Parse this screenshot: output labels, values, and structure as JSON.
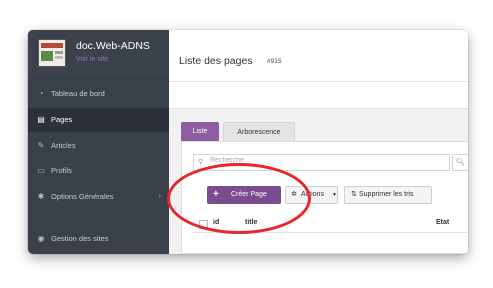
{
  "site": {
    "name": "doc.Web-ADNS",
    "view_link": "Voir le site"
  },
  "sidebar": {
    "items": [
      {
        "label": "Tableau de bord",
        "icon": "dashboard-icon",
        "glyph": "◔",
        "active": false
      },
      {
        "label": "Pages",
        "icon": "page-icon",
        "glyph": "▤",
        "active": true
      },
      {
        "label": "Articles",
        "icon": "pin-icon",
        "glyph": "✎",
        "active": false
      },
      {
        "label": "Profils",
        "icon": "card-icon",
        "glyph": "▭",
        "active": false
      },
      {
        "label": "Options Générales",
        "icon": "gear-icon",
        "glyph": "✱",
        "active": false,
        "has_submenu": true
      },
      {
        "label": "Gestion des sites",
        "icon": "globe-icon",
        "glyph": "◉",
        "active": false
      }
    ]
  },
  "header": {
    "title": "Liste des pages",
    "id": "#915"
  },
  "tabs": [
    {
      "label": "Liste",
      "active": true
    },
    {
      "label": "Arborescence",
      "active": false
    }
  ],
  "search": {
    "placeholder": "Recherche",
    "value": ""
  },
  "toolbar": {
    "create_label": "Créer Page",
    "actions_label": "Actions",
    "clear_sort_label": "Supprimer les tris"
  },
  "table": {
    "columns": [
      "id",
      "title",
      "Etat"
    ]
  },
  "colors": {
    "accent": "#7a4e8e",
    "sidebar_bg": "#39404a",
    "annotation": "#e8262b"
  }
}
